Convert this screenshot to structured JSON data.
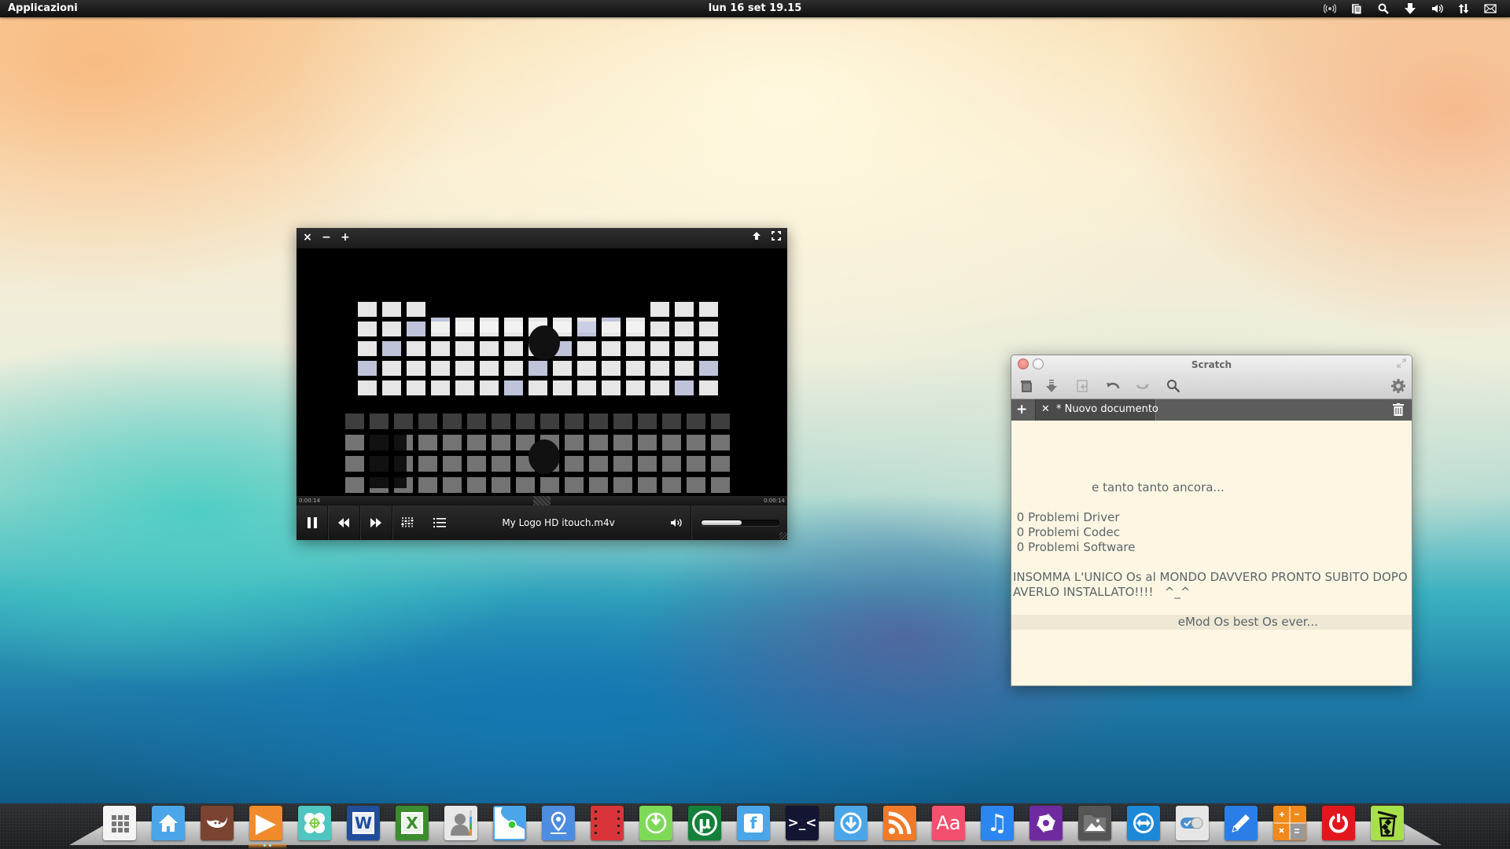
{
  "top_panel": {
    "applications_label": "Applicazioni",
    "clock": "lun 16 set 19.15",
    "tray_icons": [
      "wireless-icon",
      "clipboard-icon",
      "search-icon",
      "download-icon",
      "volume-icon",
      "network-icon",
      "mail-icon"
    ]
  },
  "player": {
    "window_buttons": {
      "close": "×",
      "minimize": "−",
      "maximize": "+"
    },
    "elapsed": "0:00:14",
    "duration": "0:00:14",
    "seek_position": 0.5,
    "file_title": "My Logo HD  itouch.m4v",
    "volume": 0.52
  },
  "scratch": {
    "title": "Scratch",
    "tab_label": "* Nuovo documento",
    "lines": [
      "",
      "",
      "",
      "",
      "                     e tanto tanto ancora...",
      "",
      " 0 Problemi Driver",
      " 0 Problemi Codec",
      " 0 Problemi Software",
      "",
      "INSOMMA L'UNICO Os al MONDO DAVVERO PRONTO SUBITO DOPO",
      "AVERLO INSTALLATO!!!!   ^_^",
      "",
      "                                            eMod Os best Os ever...",
      "",
      ""
    ],
    "highlighted_line": 13
  },
  "dock": {
    "items": [
      {
        "name": "apps-launcher",
        "glyph": "",
        "bg": "#f4f4f4"
      },
      {
        "name": "home-folder",
        "glyph": "",
        "bg": "#4aa6e8"
      },
      {
        "name": "gimp",
        "glyph": "",
        "bg": "#7a4332"
      },
      {
        "name": "media-player",
        "glyph": "▶",
        "bg": "#f08a2a"
      },
      {
        "name": "shortcuts",
        "glyph": "",
        "bg": "#4fc6c0"
      },
      {
        "name": "word",
        "glyph": "W",
        "bg": "#1f4f9a"
      },
      {
        "name": "excel",
        "glyph": "X",
        "bg": "#3c8c2f"
      },
      {
        "name": "contacts",
        "glyph": "",
        "bg": "#e8e8e8"
      },
      {
        "name": "network-manager",
        "glyph": "",
        "bg": "#4aa6e8"
      },
      {
        "name": "maps",
        "glyph": "",
        "bg": "#4c8de0"
      },
      {
        "name": "video-editor",
        "glyph": "",
        "bg": "#d8343a"
      },
      {
        "name": "download-manager",
        "glyph": "",
        "bg": "#7ed957"
      },
      {
        "name": "utorrent",
        "glyph": "µ",
        "bg": "#15803a"
      },
      {
        "name": "facebook",
        "glyph": "f",
        "bg": "#4aa6e8"
      },
      {
        "name": "terminal",
        "glyph": ">_<",
        "bg": "#141433"
      },
      {
        "name": "update-manager",
        "glyph": "",
        "bg": "#4aa6e8"
      },
      {
        "name": "rss-reader",
        "glyph": "",
        "bg": "#f07a2a"
      },
      {
        "name": "dictionary",
        "glyph": "Aa",
        "bg": "#f2506e"
      },
      {
        "name": "music",
        "glyph": "♫",
        "bg": "#2b86f0"
      },
      {
        "name": "shotwell",
        "glyph": "",
        "bg": "#6f2aa0"
      },
      {
        "name": "image-viewer",
        "glyph": "",
        "bg": "#555555"
      },
      {
        "name": "teamviewer",
        "glyph": "",
        "bg": "#1e88d8"
      },
      {
        "name": "system-settings",
        "glyph": "",
        "bg": "#e6e6e6"
      },
      {
        "name": "text-editor",
        "glyph": "",
        "bg": "#2b7ee8"
      },
      {
        "name": "calculator",
        "glyph": "",
        "bg": "#f08a1a"
      },
      {
        "name": "shutdown",
        "glyph": "",
        "bg": "#e3161e"
      },
      {
        "name": "trash",
        "glyph": "",
        "bg": "#a8e04a"
      }
    ]
  }
}
